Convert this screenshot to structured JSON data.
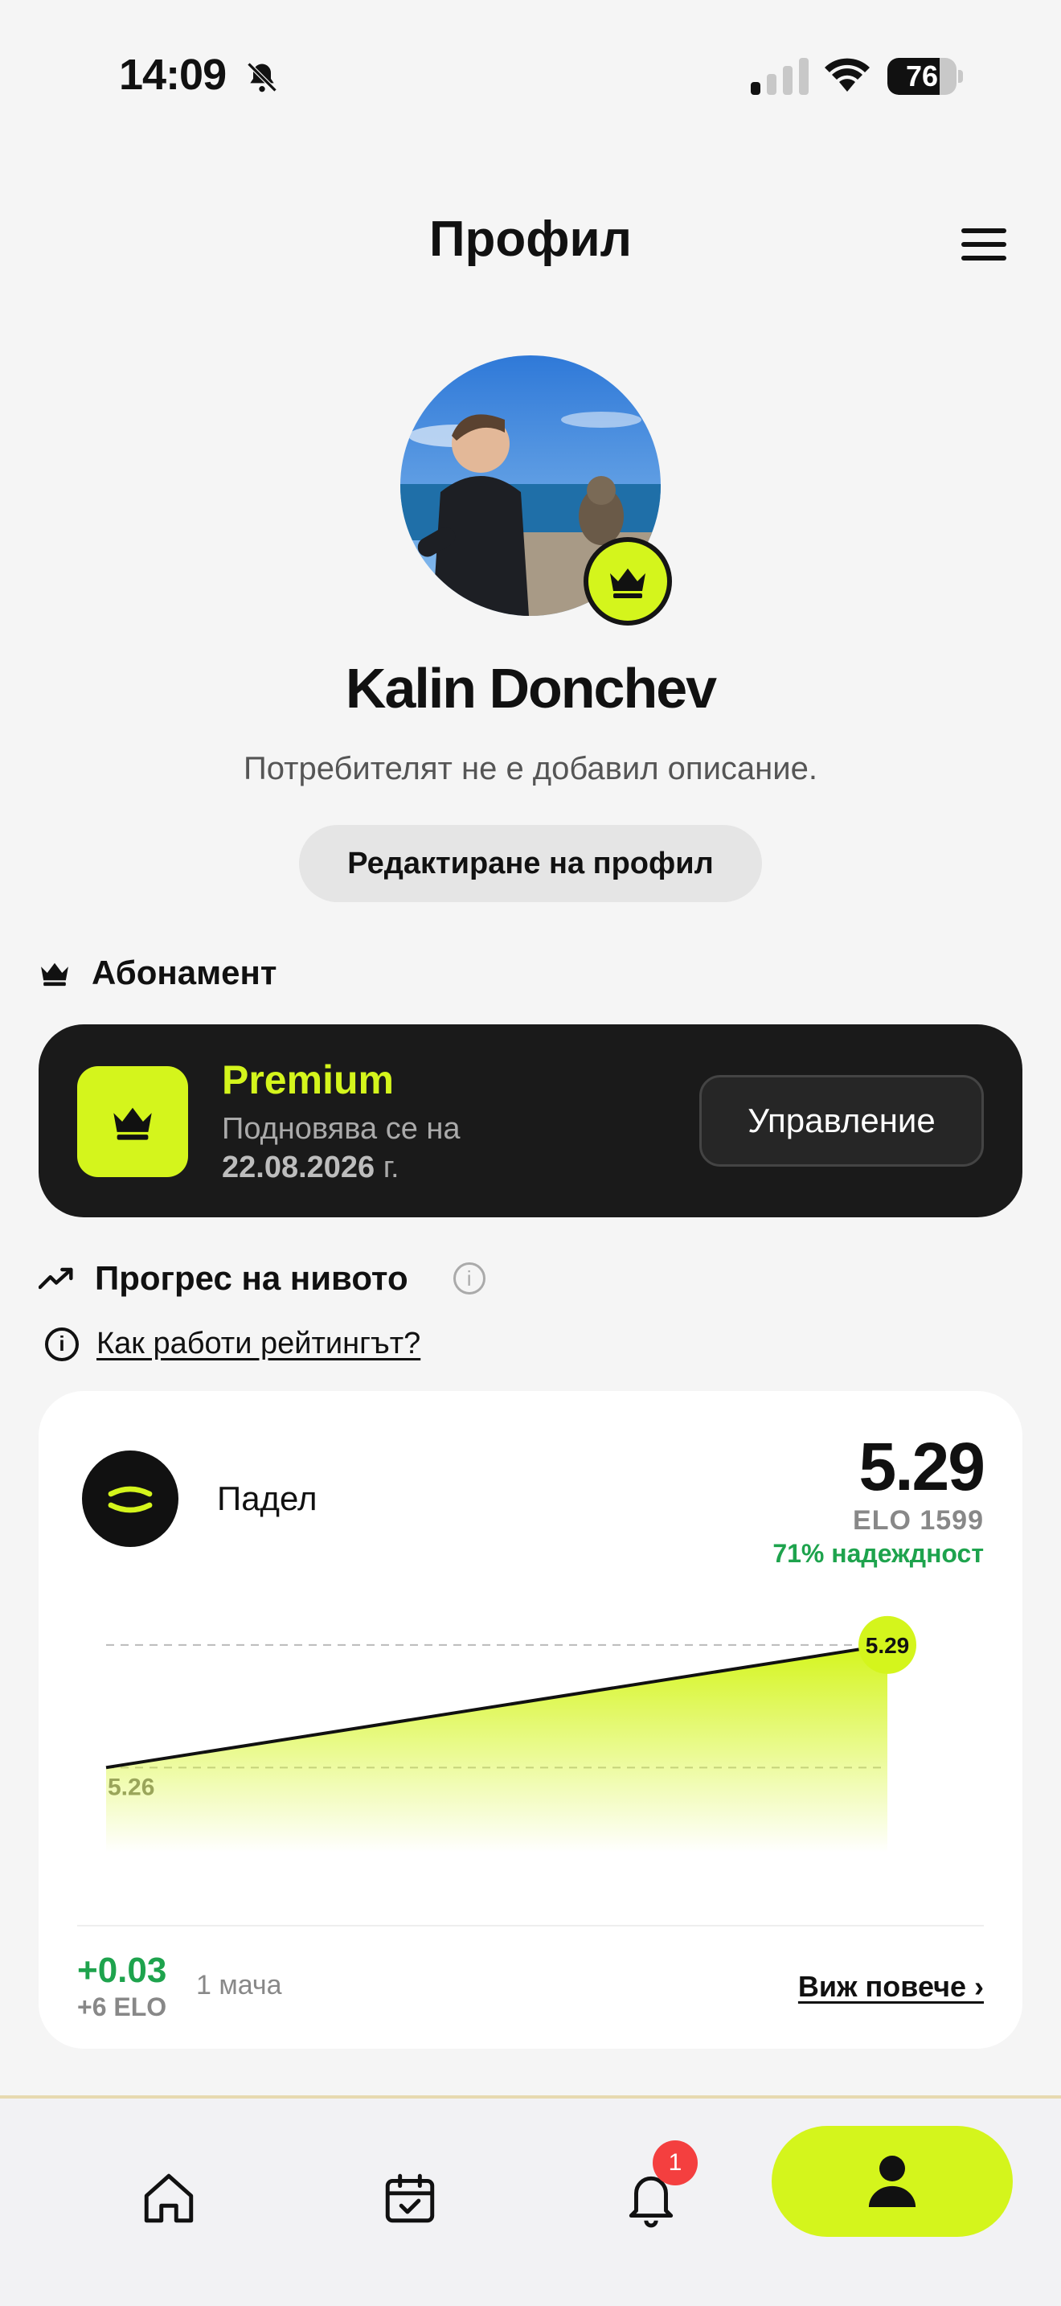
{
  "status_bar": {
    "time": "14:09",
    "battery": "76",
    "battery_level": 0.76
  },
  "header": {
    "title": "Профил"
  },
  "profile": {
    "name": "Kalin Donchev",
    "description": "Потребителят не е добавил описание.",
    "edit_button": "Редактиране на профил"
  },
  "subscription": {
    "section_title": "Абонамент",
    "plan": "Premium",
    "renew_prefix": "Подновява се на",
    "renew_date": "22.08.2026",
    "renew_suffix": "г.",
    "manage_button": "Управление"
  },
  "progress": {
    "section_title": "Прогрес на нивото",
    "info_symbol": "i",
    "how_link": "Как работи рейтингът?",
    "sport": "Падел",
    "rating": "5.29",
    "elo": "ELO 1599",
    "reliability": "71% надеждност",
    "delta": "+0.03",
    "delta_elo": "+6 ELO",
    "matches": "1 мача",
    "see_more": "Виж повече ›"
  },
  "chart_data": {
    "type": "area",
    "x": [
      1,
      2
    ],
    "values": [
      5.26,
      5.29
    ],
    "labels": [
      "5.26",
      "5.29"
    ],
    "ylim": [
      5.24,
      5.3
    ],
    "color": "#d4f51c"
  },
  "nav": {
    "items": [
      "home-icon",
      "calendar-icon",
      "bell-icon",
      "person-icon"
    ],
    "notification_count": "1",
    "accent": "#d4f51c"
  }
}
